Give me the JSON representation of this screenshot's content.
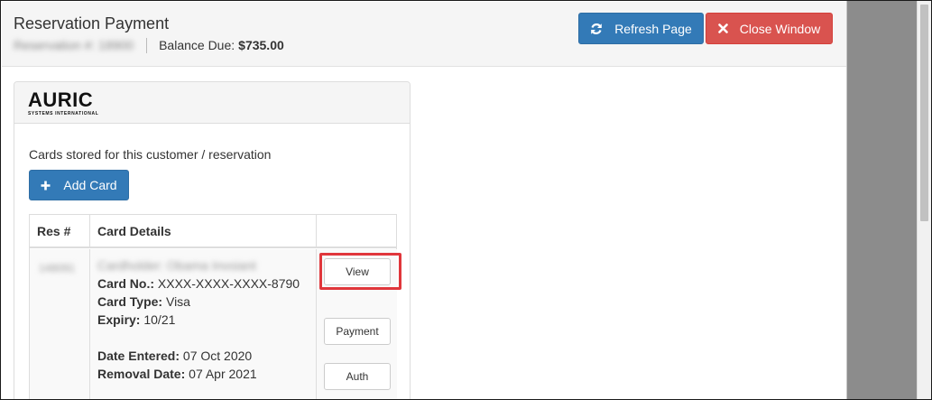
{
  "header": {
    "title": "Reservation Payment",
    "reservation_label": "Reservation #: 18900",
    "balance_label": "Balance Due:",
    "balance_value": "$735.00",
    "refresh_label": "Refresh Page",
    "close_label": "Close Window"
  },
  "panel": {
    "logo_text": "AURIC",
    "logo_subtext": "SYSTEMS INTERNATIONAL",
    "cards_label": "Cards stored for this customer / reservation",
    "add_card_label": "Add Card"
  },
  "table": {
    "headers": [
      "Res #",
      "Card Details",
      ""
    ],
    "rows": [
      {
        "res": "148091",
        "cardholder": "Cardholder: Obama Invoiant",
        "card_no_label": "Card No.:",
        "card_no": "XXXX-XXXX-XXXX-8790",
        "card_type_label": "Card Type:",
        "card_type": "Visa",
        "expiry_label": "Expiry:",
        "expiry": "10/21",
        "date_entered_label": "Date Entered:",
        "date_entered": "07 Oct 2020",
        "removal_label": "Removal Date:",
        "removal_date": "07 Apr 2021",
        "actions": [
          "View",
          "Payment",
          "Auth"
        ]
      }
    ]
  },
  "colors": {
    "primary": "#337ab7",
    "danger": "#d9534f",
    "highlight": "#e0363b",
    "logo_accent": "#f0b400"
  },
  "icons": {
    "refresh": "refresh-icon",
    "close": "close-icon",
    "add": "plus-icon"
  }
}
